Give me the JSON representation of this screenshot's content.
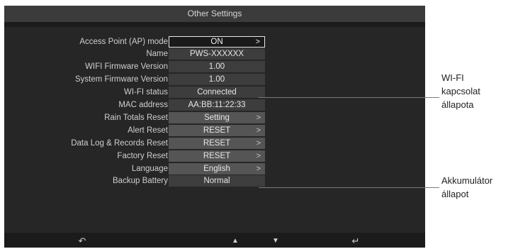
{
  "title": "Other Settings",
  "rows": [
    {
      "label": "Access Point (AP) mode",
      "value": "ON",
      "arrow": ">"
    },
    {
      "label": "Name",
      "value": "PWS-XXXXXX",
      "arrow": ""
    },
    {
      "label": "WIFI Firmware Version",
      "value": "1.00",
      "arrow": ""
    },
    {
      "label": "System Firmware Version",
      "value": "1.00",
      "arrow": ""
    },
    {
      "label": "WI-FI status",
      "value": "Connected",
      "arrow": ""
    },
    {
      "label": "MAC address",
      "value": "AA:BB:11:22:33",
      "arrow": ""
    },
    {
      "label": "Rain Totals Reset",
      "value": "Setting",
      "arrow": ">"
    },
    {
      "label": "Alert Reset",
      "value": "RESET",
      "arrow": ">"
    },
    {
      "label": "Data Log & Records Reset",
      "value": "RESET",
      "arrow": ">"
    },
    {
      "label": "Factory Reset",
      "value": "RESET",
      "arrow": ">"
    },
    {
      "label": "Language",
      "value": "English",
      "arrow": ">"
    },
    {
      "label": "Backup Battery",
      "value": "Normal",
      "arrow": ""
    }
  ],
  "footer": {
    "back": "↶",
    "up": "▲",
    "down": "▼",
    "enter": "↵"
  },
  "annotations": {
    "wifi": [
      "WI-FI",
      "kapcsolat",
      "állapota"
    ],
    "battery": [
      "Akkumulátor",
      "állapot"
    ]
  },
  "colors": {
    "screen_bg": "#1b1b1b",
    "titlebar_bg": "#3b3b3b",
    "value_bg": "#3d3d3d",
    "action_bg": "#555555"
  }
}
